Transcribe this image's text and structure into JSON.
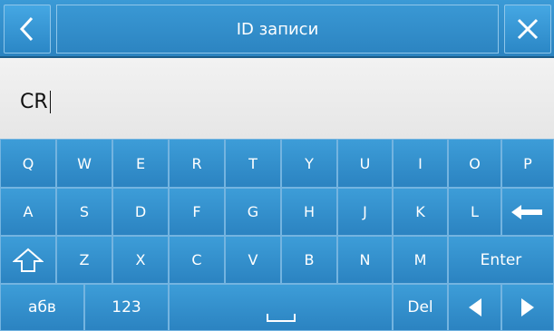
{
  "header": {
    "title": "ID записи",
    "back_icon": "chevron-left-icon",
    "close_icon": "close-icon"
  },
  "input": {
    "value": "CR"
  },
  "keyboard": {
    "row1": [
      "Q",
      "W",
      "E",
      "R",
      "T",
      "Y",
      "U",
      "I",
      "O",
      "P"
    ],
    "row2": [
      "A",
      "S",
      "D",
      "F",
      "G",
      "H",
      "J",
      "K",
      "L"
    ],
    "row2_backspace_icon": "backspace-arrow-icon",
    "row3": [
      "Z",
      "X",
      "C",
      "V",
      "B",
      "N",
      "M"
    ],
    "shift_icon": "shift-icon",
    "enter_label": "Enter",
    "abc_label": "абв",
    "numbers_label": "123",
    "space_icon": "space-icon",
    "del_label": "Del",
    "left_icon": "triangle-left-icon",
    "right_icon": "triangle-right-icon"
  },
  "colors": {
    "key_fill": "#2b83c1",
    "key_border": "#74b4e0",
    "input_bg": "#eeeeee",
    "keyboard_bg": "#1c5f8d"
  }
}
